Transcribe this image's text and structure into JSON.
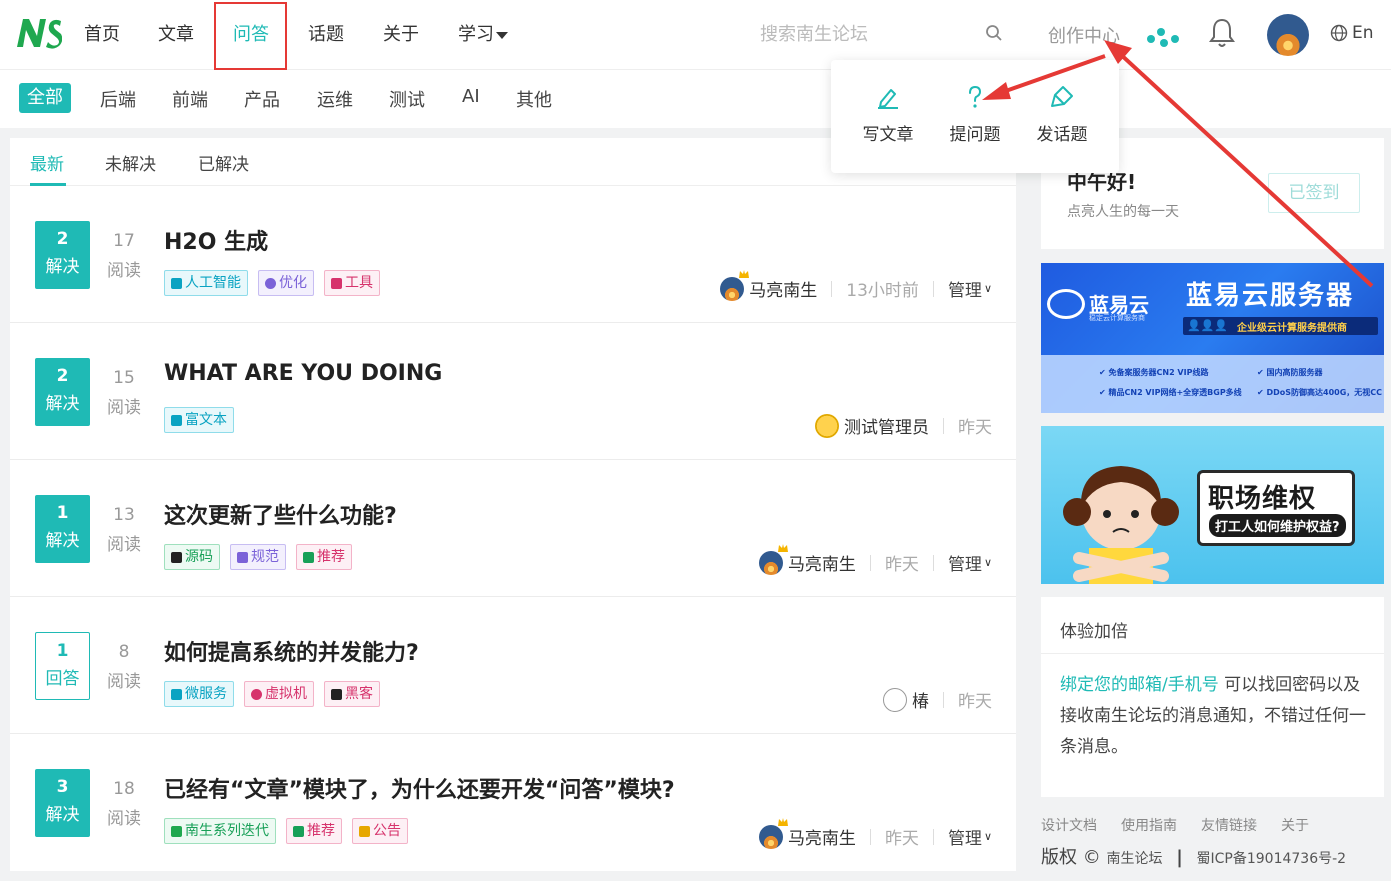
{
  "header": {
    "logo_text": "NS",
    "nav": [
      {
        "label": "首页"
      },
      {
        "label": "文章"
      },
      {
        "label": "问答"
      },
      {
        "label": "话题"
      },
      {
        "label": "关于"
      },
      {
        "label": "学习"
      }
    ],
    "active_nav": "问答",
    "search_placeholder": "搜索南生论坛",
    "create_center": "创作中心",
    "lang": "En"
  },
  "categories": [
    "全部",
    "后端",
    "前端",
    "产品",
    "运维",
    "测试",
    "AI",
    "其他"
  ],
  "dropdown": {
    "items": [
      {
        "label": "写文章",
        "icon": "pencil-icon"
      },
      {
        "label": "提问题",
        "icon": "question-icon"
      },
      {
        "label": "发话题",
        "icon": "brush-icon"
      }
    ]
  },
  "subtabs": [
    "最新",
    "未解决",
    "已解决"
  ],
  "questions": [
    {
      "count": "2",
      "status": "解决",
      "solved": true,
      "reads": "17",
      "reads_label": "阅读",
      "title": "H2O 生成",
      "tags": [
        {
          "label": "人工智能",
          "style": "t1"
        },
        {
          "label": "优化",
          "style": "t2"
        },
        {
          "label": "工具",
          "style": "t3"
        }
      ],
      "author": "马亮南生",
      "time": "13小时前",
      "manage": "管理"
    },
    {
      "count": "2",
      "status": "解决",
      "solved": true,
      "reads": "15",
      "reads_label": "阅读",
      "title": "WHAT ARE YOU DOING",
      "tags": [
        {
          "label": "富文本",
          "style": "t1"
        }
      ],
      "author": "测试管理员",
      "time": "昨天",
      "manage": ""
    },
    {
      "count": "1",
      "status": "解决",
      "solved": true,
      "reads": "13",
      "reads_label": "阅读",
      "title": "这次更新了些什么功能?",
      "tags": [
        {
          "label": "源码",
          "style": "t4"
        },
        {
          "label": "规范",
          "style": "t2"
        },
        {
          "label": "推荐",
          "style": "t3"
        }
      ],
      "author": "马亮南生",
      "time": "昨天",
      "manage": "管理"
    },
    {
      "count": "1",
      "status": "回答",
      "solved": false,
      "reads": "8",
      "reads_label": "阅读",
      "title": "如何提高系统的并发能力?",
      "tags": [
        {
          "label": "微服务",
          "style": "t1"
        },
        {
          "label": "虚拟机",
          "style": "t3"
        },
        {
          "label": "黑客",
          "style": "t3"
        }
      ],
      "author": "椿",
      "time": "昨天",
      "manage": ""
    },
    {
      "count": "3",
      "status": "解决",
      "solved": true,
      "reads": "18",
      "reads_label": "阅读",
      "title": "已经有“文章”模块了，为什么还要开发“问答”模块?",
      "tags": [
        {
          "label": "南生系列迭代",
          "style": "t4"
        },
        {
          "label": "推荐",
          "style": "t3"
        },
        {
          "label": "公告",
          "style": "t3"
        }
      ],
      "author": "马亮南生",
      "time": "昨天",
      "manage": "管理"
    }
  ],
  "sidebar": {
    "greeting": "中午好!",
    "greeting_sub": "点亮人生的每一天",
    "signin": "已签到",
    "ad1": {
      "brand": "蓝易云",
      "brand_sub": "稳定云计算服务商",
      "title": "蓝易云服务器",
      "tagline": "企业级云计算服务提供商",
      "features": [
        "免备案服务器CN2 VIP线路",
        "国内高防服务器",
        "精品CN2 VIP网络+全穿透BGP多线",
        "DDoS防御高达400G，无视CC"
      ]
    },
    "ad2": {
      "title": "职场维权",
      "subtitle": "打工人如何维护权益?"
    },
    "card2_title": "体验加倍",
    "card2_link": "绑定您的邮箱/手机号",
    "card2_text": "可以找回密码以及接收南生论坛的消息通知，不错过任何一条消息。",
    "footer_links": [
      "设计文档",
      "使用指南",
      "友情链接",
      "关于"
    ],
    "copyright": "版权 ©",
    "site_name": "南生论坛",
    "icp": "蜀ICP备19014736号-2"
  },
  "colors": {
    "accent": "#1fbab5",
    "annotation_red": "#e53935"
  }
}
